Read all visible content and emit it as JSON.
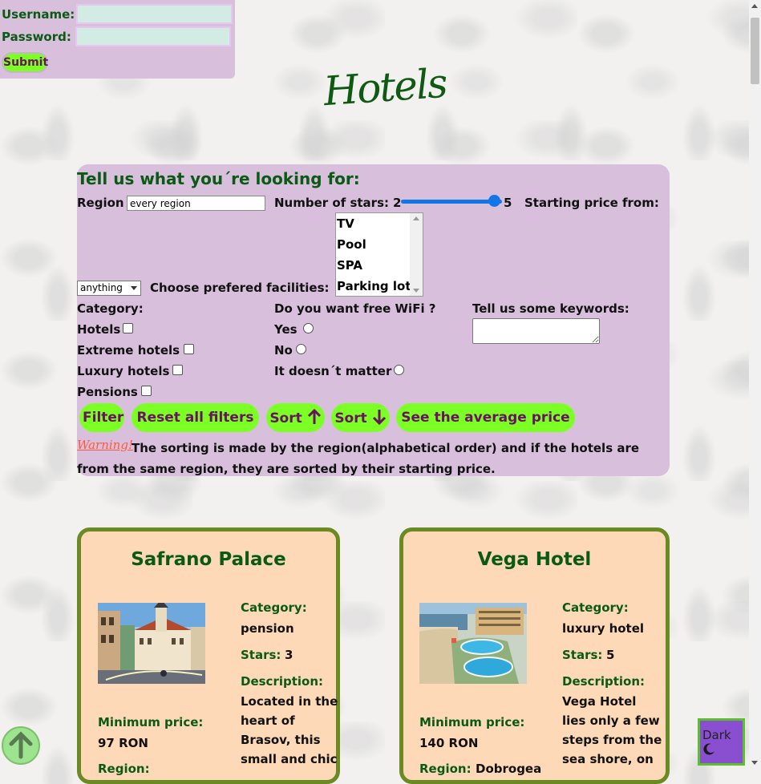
{
  "login": {
    "username_label": "Username:",
    "password_label": "Password:",
    "submit_label": "Submit",
    "username_value": "",
    "password_value": ""
  },
  "page_title": "Hotels",
  "filters": {
    "heading": "Tell us what you´re looking for:",
    "region_label": "Region",
    "region_value": "every region",
    "stars_label": "Number of stars:",
    "stars_min": "2",
    "stars_max": "5",
    "stars_level": 0.92,
    "price_label": "Starting price from:",
    "price_selected": "anything",
    "facilities_label": "Choose prefered facilities:",
    "facilities": [
      "TV",
      "Pool",
      "SPA",
      "Parking lot"
    ],
    "category_label": "Category:",
    "categories": [
      "Hotels",
      "Extreme hotels",
      "Luxury hotels",
      "Pensions"
    ],
    "wifi_label": "Do you want free WiFi ?",
    "wifi_options": [
      "Yes",
      "No",
      "It doesn´t matter"
    ],
    "keywords_label": "Tell us some keywords:",
    "keywords_value": "",
    "buttons": {
      "filter": "Filter",
      "reset": "Reset all filters",
      "sort_up": "Sort",
      "sort_down": "Sort",
      "average": "See the average price"
    },
    "warning_label": "Warning!",
    "warning_text": "The sorting is made by the region(alphabetical order) and if the hotels are from the same region, they are sorted by their starting price."
  },
  "hotels": [
    {
      "name": "Safrano Palace",
      "category_label": "Category:",
      "category": "pension",
      "stars_label": "Stars:",
      "stars": "3",
      "description_label": "Description:",
      "description": "Located in the heart of Brasov, this small and chic",
      "min_price_label": "Minimum price:",
      "min_price": "97 RON",
      "region_label": "Region:",
      "region": ""
    },
    {
      "name": "Vega Hotel",
      "category_label": "Category:",
      "category": "luxury hotel",
      "stars_label": "Stars:",
      "stars": "5",
      "description_label": "Description:",
      "description": "Vega Hotel lies only a few steps from the sea shore, on",
      "min_price_label": "Minimum price:",
      "min_price": "140 RON",
      "region_label": "Region:",
      "region": "Dobrogea"
    }
  ],
  "dark_mode_label": "Dark",
  "colors": {
    "panel": "#d8bfdc",
    "button": "#7cff24",
    "button_text": "#6a1262",
    "heading_green": "#0a5a14",
    "card_bg": "#fed9b8",
    "card_border": "#6b8a23"
  }
}
